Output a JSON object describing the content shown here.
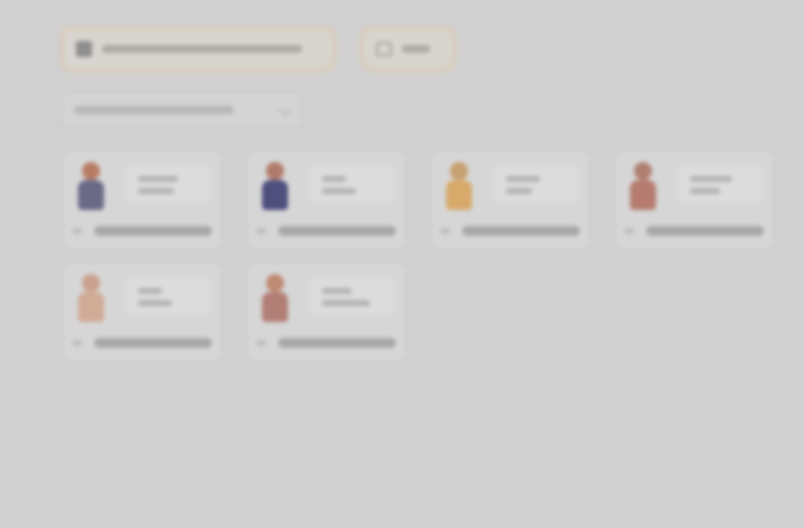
{
  "toolbar": {
    "add_label": "",
    "filter_label": ""
  },
  "select": {
    "value": ""
  },
  "cards": [
    {
      "name": "",
      "detail": "",
      "avatar_colors": {
        "head": "#b87c63",
        "body": "#6b6a86"
      }
    },
    {
      "name": "",
      "detail": "",
      "avatar_colors": {
        "head": "#b07a6a",
        "body": "#4f4f7e"
      }
    },
    {
      "name": "",
      "detail": "",
      "avatar_colors": {
        "head": "#c7a070",
        "body": "#d7aa6b"
      }
    },
    {
      "name": "",
      "detail": "",
      "avatar_colors": {
        "head": "#b07f70",
        "body": "#b57c6f"
      }
    },
    {
      "name": "",
      "detail": "",
      "avatar_colors": {
        "head": "#caa08d",
        "body": "#d0ab95"
      }
    },
    {
      "name": "",
      "detail": "",
      "avatar_colors": {
        "head": "#bf8973",
        "body": "#b27f76"
      }
    }
  ],
  "colors": {
    "background": "#d0d0d0",
    "accent_border": "#dccab5"
  }
}
